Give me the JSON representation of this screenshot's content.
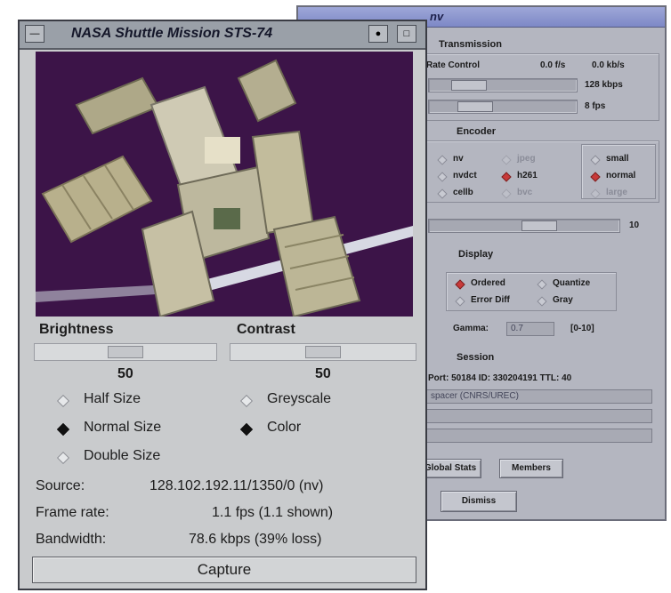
{
  "back_window": {
    "title": "nv",
    "transmission": {
      "header": "Transmission",
      "rate_control_label": "Rate Control",
      "rate_fps": "0.0 f/s",
      "rate_kbps": "0.0 kb/s",
      "bandwidth_value": "128 kbps",
      "bandwidth_fraction": 0.2,
      "framerate_value": "8 fps",
      "framerate_fraction": 0.25
    },
    "encoder": {
      "header": "Encoder",
      "options": [
        "nv",
        "nvdct",
        "cellb",
        "jpeg",
        "h261",
        "bvc"
      ],
      "selected": "h261",
      "disabled": [
        "jpeg",
        "bvc"
      ],
      "sizes": [
        "small",
        "normal",
        "large"
      ],
      "selected_size": "normal",
      "disabled_sizes": [
        "large"
      ],
      "quality_value": "10",
      "quality_fraction": 0.6
    },
    "display": {
      "header": "Display",
      "options": [
        "Ordered",
        "Quantize",
        "Error Diff",
        "Gray"
      ],
      "selected": "Ordered",
      "gamma_label": "Gamma:",
      "gamma_value": "0.7",
      "gamma_range": "[0-10]"
    },
    "session": {
      "header": "Session",
      "info": "Port: 50184  ID: 330204191  TTL: 40",
      "address": "spacer (CNRS/UREC)",
      "buttons": [
        "Global Stats",
        "Members"
      ],
      "dismiss": "Dismiss"
    }
  },
  "front_window": {
    "title": "NASA Shuttle Mission STS-74",
    "brightness": {
      "label": "Brightness",
      "value": "50",
      "fraction": 0.5
    },
    "contrast": {
      "label": "Contrast",
      "value": "50",
      "fraction": 0.5
    },
    "size_options": [
      "Half Size",
      "Normal Size",
      "Double Size"
    ],
    "selected_size": "Normal Size",
    "color_options": [
      "Greyscale",
      "Color"
    ],
    "selected_color": "Color",
    "source_label": "Source:",
    "source_value": "128.102.192.11/1350/0 (nv)",
    "framerate_label": "Frame rate:",
    "framerate_value": "1.1  fps (1.1 shown)",
    "bandwidth_label": "Bandwidth:",
    "bandwidth_value": "78.6 kbps (39% loss)",
    "capture_label": "Capture"
  },
  "colors": {
    "video_bg": "#3c1448",
    "back_titlebar": "#8d96d0",
    "front_titlebar": "#9aa0a8"
  }
}
